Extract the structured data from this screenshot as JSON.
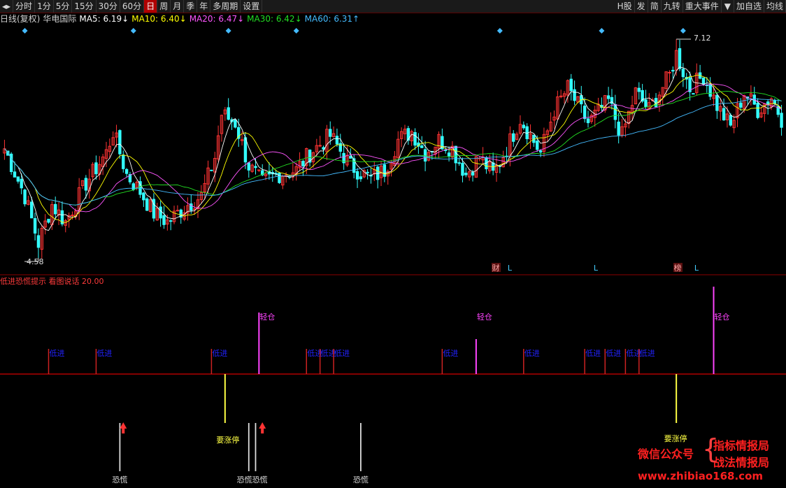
{
  "toolbar": {
    "left_icon": "pin-icon",
    "periods": [
      "分时",
      "1分",
      "5分",
      "15分",
      "30分",
      "60分",
      "日",
      "周",
      "月",
      "季",
      "年",
      "多周期",
      "设置"
    ],
    "active_period": "日",
    "right_items": [
      "H股",
      "发",
      "简",
      "九转",
      "重大事件",
      "加自选",
      "均线"
    ],
    "dropdown_icon": "triangle-down-icon"
  },
  "ma_line": {
    "label": "日线(复权)",
    "stock": "华电国际",
    "ma": [
      {
        "text": "MA5: 6.19↓",
        "color": "#ffffff"
      },
      {
        "text": "MA10: 6.40↓",
        "color": "#ffff00"
      },
      {
        "text": "MA20: 6.47↓",
        "color": "#ff55ff"
      },
      {
        "text": "MA30: 6.42↓",
        "color": "#22dd22"
      },
      {
        "text": "MA60: 6.31↑",
        "color": "#44bbff"
      }
    ]
  },
  "price_labels": {
    "high": "7.12",
    "low": "4.58"
  },
  "event_markers": [
    {
      "text": "财",
      "boxed": true
    },
    {
      "text": "L",
      "boxed": false
    },
    {
      "text": "L",
      "boxed": false
    },
    {
      "text": "榜",
      "boxed": true
    },
    {
      "text": "L",
      "boxed": false
    }
  ],
  "indicator": {
    "title": "低进恐慌提示 看图说话 20.00",
    "buy_label": "低进",
    "light_label": "轻仓",
    "limit_up_label": "要涨停",
    "panic_label": "恐慌",
    "panic_stacked_label": "恐慌恐慌"
  },
  "watermark": {
    "left": "微信公众号",
    "right1": "指标情报局",
    "right2": "战法情报局",
    "url": "www.zhibiao168.com"
  },
  "colors": {
    "up": "#ff3333",
    "down": "#33ffff",
    "axis": "#8b0000",
    "buy": "#2222ff",
    "light": "#ff44ff",
    "limit": "#ffff44",
    "panic": "#dddddd"
  },
  "chart_data": {
    "type": "candlestick",
    "n_days": 230,
    "price_range": [
      4.58,
      7.12
    ],
    "high_marker": 7.12,
    "low_marker": 4.58,
    "close_samples": [
      [
        0,
        5.85
      ],
      [
        6,
        5.3
      ],
      [
        10,
        4.75
      ],
      [
        14,
        5.2
      ],
      [
        18,
        5.0
      ],
      [
        24,
        5.45
      ],
      [
        30,
        5.8
      ],
      [
        32,
        6.05
      ],
      [
        36,
        5.55
      ],
      [
        40,
        5.35
      ],
      [
        44,
        5.1
      ],
      [
        48,
        5.0
      ],
      [
        54,
        5.2
      ],
      [
        58,
        5.3
      ],
      [
        62,
        5.75
      ],
      [
        64,
        6.25
      ],
      [
        68,
        6.15
      ],
      [
        72,
        5.65
      ],
      [
        76,
        5.45
      ],
      [
        80,
        5.55
      ],
      [
        86,
        5.6
      ],
      [
        90,
        5.8
      ],
      [
        96,
        6.0
      ],
      [
        102,
        5.65
      ],
      [
        108,
        5.5
      ],
      [
        112,
        5.6
      ],
      [
        116,
        5.95
      ],
      [
        120,
        6.05
      ],
      [
        124,
        5.8
      ],
      [
        128,
        5.95
      ],
      [
        132,
        5.85
      ],
      [
        136,
        5.55
      ],
      [
        140,
        5.75
      ],
      [
        144,
        5.55
      ],
      [
        148,
        5.85
      ],
      [
        152,
        6.2
      ],
      [
        158,
        5.8
      ],
      [
        162,
        6.3
      ],
      [
        166,
        6.55
      ],
      [
        172,
        6.15
      ],
      [
        178,
        6.4
      ],
      [
        182,
        6.0
      ],
      [
        186,
        6.5
      ],
      [
        190,
        6.3
      ],
      [
        196,
        6.7
      ],
      [
        198,
        6.95
      ],
      [
        202,
        6.55
      ],
      [
        206,
        6.7
      ],
      [
        210,
        6.35
      ],
      [
        214,
        6.1
      ],
      [
        218,
        6.5
      ],
      [
        222,
        6.3
      ],
      [
        226,
        6.45
      ],
      [
        229,
        6.2
      ]
    ],
    "signals": {
      "buy_days": [
        13,
        27,
        61,
        89,
        93,
        97,
        129,
        153,
        171,
        177,
        183,
        187
      ],
      "light_days": [
        75,
        139,
        209
      ],
      "light_heights": [
        88,
        50,
        125
      ],
      "limit_up_days": [
        65,
        198
      ],
      "panic_days": [
        34,
        72,
        74,
        105
      ],
      "panic_arrow_days": [
        35,
        76
      ]
    }
  }
}
